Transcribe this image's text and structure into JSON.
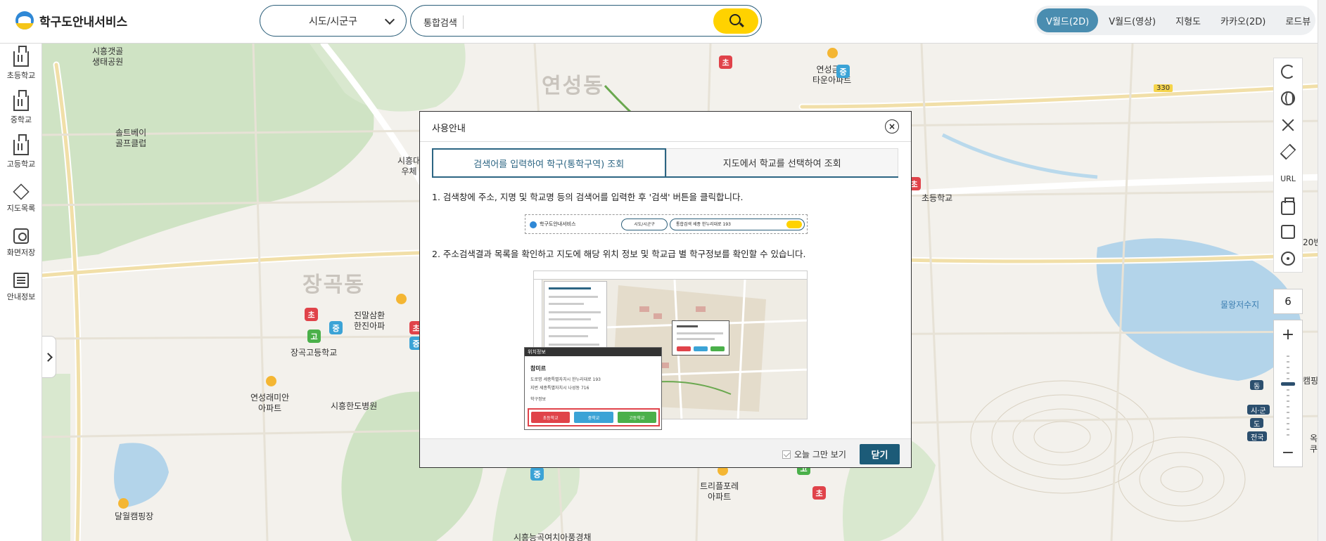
{
  "header": {
    "logo_text": "학구도안내서비스",
    "region_select": "시도/시군구",
    "search_label": "통합검색",
    "search_placeholder": "",
    "map_tabs": [
      {
        "label": "V월드(2D)",
        "active": true
      },
      {
        "label": "V월드(영상)",
        "active": false
      },
      {
        "label": "지형도",
        "active": false
      },
      {
        "label": "카카오(2D)",
        "active": false
      },
      {
        "label": "로드뷰",
        "active": false
      }
    ]
  },
  "sidebar": {
    "items": [
      {
        "label": "초등학교",
        "icon": "school-building-icon"
      },
      {
        "label": "중학교",
        "icon": "school-building-icon"
      },
      {
        "label": "고등학교",
        "icon": "school-building-icon"
      },
      {
        "label": "지도목록",
        "icon": "layers-icon"
      },
      {
        "label": "화면저장",
        "icon": "camera-icon"
      },
      {
        "label": "안내정보",
        "icon": "document-icon"
      }
    ]
  },
  "tools": {
    "url_label": "URL",
    "zoom_level": "6",
    "zoom_in": "+",
    "zoom_out": "−",
    "scale_tags": [
      "동",
      "시·군",
      "도",
      "전국"
    ]
  },
  "map": {
    "labels": [
      {
        "text": "시흥갯골\n생태공원",
        "kind": "normal"
      },
      {
        "text": "솔트베이\n골프클럽",
        "kind": "normal"
      },
      {
        "text": "연성동",
        "kind": "big"
      },
      {
        "text": "연성금호\n타운아파트",
        "kind": "normal"
      },
      {
        "text": "330",
        "kind": "road"
      },
      {
        "text": "시흥대\n우체",
        "kind": "normal"
      },
      {
        "text": "장곡동",
        "kind": "big"
      },
      {
        "text": "진말삼환\n한진아파",
        "kind": "normal"
      },
      {
        "text": "장곡고등학교",
        "kind": "normal"
      },
      {
        "text": "연성래미안\n아파트",
        "kind": "normal"
      },
      {
        "text": "시흥한도병원",
        "kind": "normal"
      },
      {
        "text": "초등학교",
        "kind": "normal"
      },
      {
        "text": "물왕저수지",
        "kind": "water"
      },
      {
        "text": "트리플포레\n아파트",
        "kind": "normal"
      },
      {
        "text": "달월캠핑장",
        "kind": "normal"
      },
      {
        "text": "시흥능곡여치아풍경채",
        "kind": "normal"
      },
      {
        "text": "캠핑",
        "kind": "normal"
      },
      {
        "text": "20번",
        "kind": "normal"
      },
      {
        "text": "옥\n쿠",
        "kind": "normal"
      }
    ],
    "poi_elem": "초",
    "poi_mid": "중",
    "poi_high": "고"
  },
  "modal": {
    "title": "사용안내",
    "close_icon": "×",
    "tabs": [
      {
        "label": "검색어를 입력하여 학구(통학구역) 조회",
        "active": true
      },
      {
        "label": "지도에서 학교를 선택하여 조회",
        "active": false
      }
    ],
    "step1": "1. 검색창에 주소, 지명 및 학교명 등의 검색어를 입력한 후 '검색' 버튼을 클릭합니다.",
    "step2": "2. 주소검색결과 목록을 확인하고 지도에 해당 위치 정보 및 학교급 별 학구정보를 확인할 수 있습니다.",
    "preview1": {
      "logo": "학구도안내서비스",
      "select": "시도/시군구",
      "search": "통합검색  세종 한누리대로 193"
    },
    "popup": {
      "header": "위치정보",
      "title": "참미르",
      "row1": "도로명  세종특별자치시 한누리대로 193",
      "row2": "지번   세종특별자치시 나성동 716",
      "row3": "학구정보",
      "buttons": [
        "초등학교",
        "중학교",
        "고등학교"
      ]
    },
    "dont_show": "오늘 그만 보기",
    "close_button": "닫기"
  },
  "colors": {
    "accent": "#1c5b78",
    "search_yellow": "#ffd200",
    "elem": "#e0434a",
    "mid": "#3ba3d6",
    "high": "#4ab04a"
  }
}
